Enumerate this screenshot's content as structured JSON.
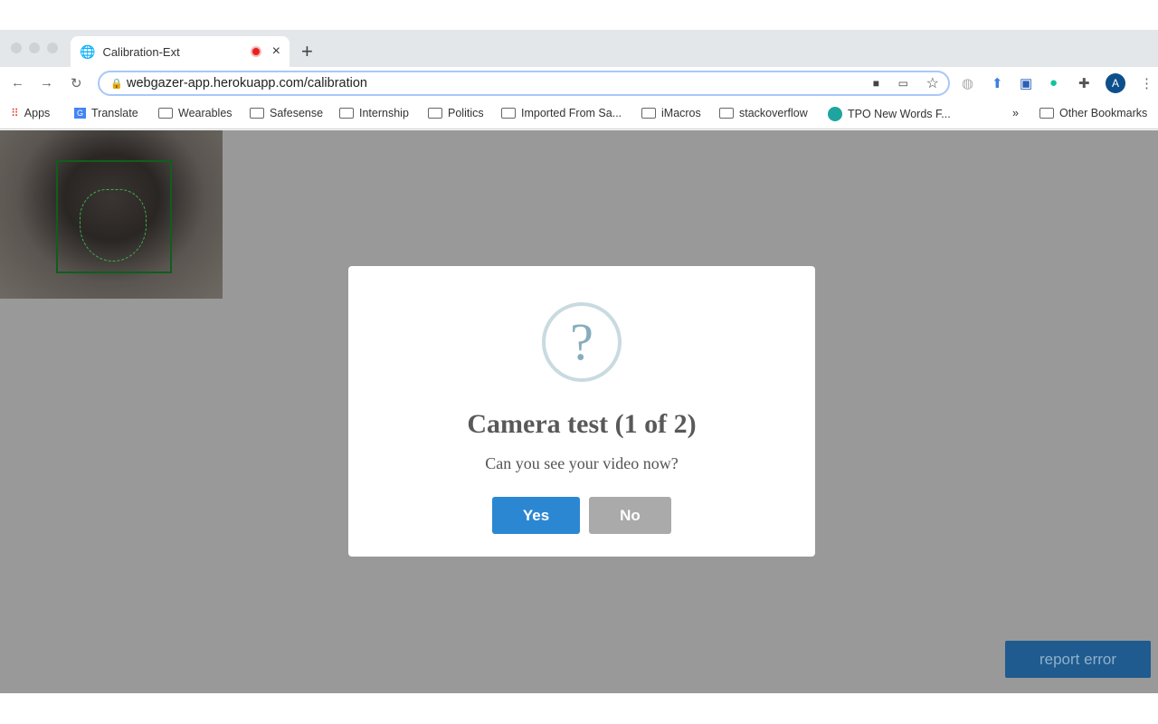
{
  "browser": {
    "tab": {
      "title": "Calibration-Ext",
      "recording": true
    },
    "url": "webgazer-app.herokuapp.com/calibration",
    "bookmarks": [
      "Apps",
      "Translate",
      "Wearables",
      "Safesense",
      "Internship",
      "Politics",
      "Imported From Sa...",
      "iMacros",
      "stackoverflow",
      "TPO New Words F..."
    ],
    "overflow": "»",
    "other_bookmarks": "Other Bookmarks",
    "profile_initial": "A"
  },
  "dialog": {
    "icon": "?",
    "title": "Camera test (1 of 2)",
    "message": "Can you see your video now?",
    "yes_label": "Yes",
    "no_label": "No"
  },
  "report_error_label": "report error",
  "colors": {
    "primary": "#2c87d3",
    "secondary": "#aaaaaa",
    "overlay": "#999999"
  }
}
